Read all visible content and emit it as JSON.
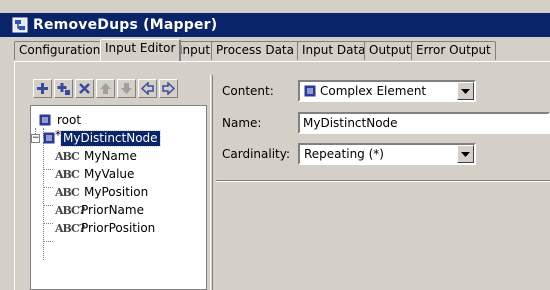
{
  "window": {
    "title": "RemoveDups (Mapper)"
  },
  "tabs": [
    {
      "label": "Configuration",
      "active": false
    },
    {
      "label": "Input Editor",
      "active": true
    },
    {
      "label": "Input",
      "active": false
    },
    {
      "label": "Process Data",
      "active": false
    },
    {
      "label": "Input Data",
      "active": false
    },
    {
      "label": "Output",
      "active": false
    },
    {
      "label": "Error Output",
      "active": false
    }
  ],
  "toolbar": {
    "buttons": [
      "add-icon",
      "add-child-icon",
      "delete-icon",
      "move-up-icon",
      "move-down-icon",
      "move-left-icon",
      "move-right-icon"
    ]
  },
  "tree": {
    "root": "root",
    "selected_node": "MyDistinctNode",
    "selected_marker": "*",
    "children": [
      {
        "label": "MyName",
        "icon": "ABC",
        "optional": false
      },
      {
        "label": "MyValue",
        "icon": "ABC",
        "optional": false
      },
      {
        "label": "MyPosition",
        "icon": "ABC",
        "optional": false
      },
      {
        "label": "PriorName",
        "icon": "ABC?",
        "optional": true
      },
      {
        "label": "PriorPosition",
        "icon": "ABC?",
        "optional": true
      }
    ]
  },
  "form": {
    "content_label": "Content:",
    "content_value": "Complex Element",
    "name_label": "Name:",
    "name_value": "MyDistinctNode",
    "cardinality_label": "Cardinality:",
    "cardinality_value": "Repeating (*)"
  },
  "colors": {
    "titlebar": "#0a246a",
    "selection": "#0a246a",
    "element_icon": "#2a3a9a",
    "toolbar_icon": "#3a4aa0"
  }
}
